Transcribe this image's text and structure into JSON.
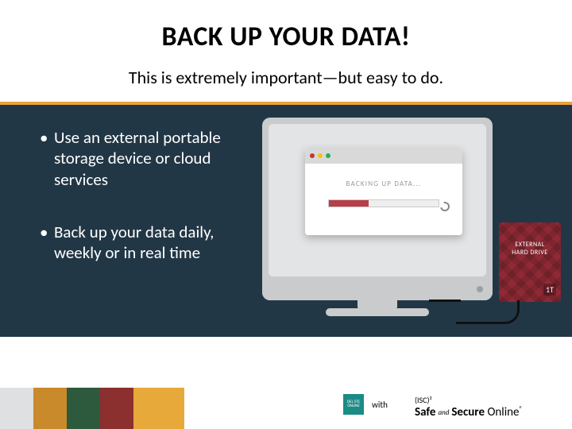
{
  "title": "BACK UP YOUR DATA!",
  "subtitle": "This is extremely important—but easy to do.",
  "bullets": [
    "Use an external portable storage device or cloud services",
    "Back up your data daily, weekly or in real time"
  ],
  "dialog": {
    "text": "BACKING UP DATA..."
  },
  "drive": {
    "line1": "EXTERNAL",
    "line2": "HARD DRIVE",
    "capacity": "1T"
  },
  "footer": {
    "badge_text": "DEL STE ONLINE",
    "with": "with",
    "isc2": "(ISC)²",
    "brand_bold1": "Safe",
    "brand_and": "and",
    "brand_bold2": "Secure",
    "brand_tail": "Online",
    "trade": "®"
  }
}
